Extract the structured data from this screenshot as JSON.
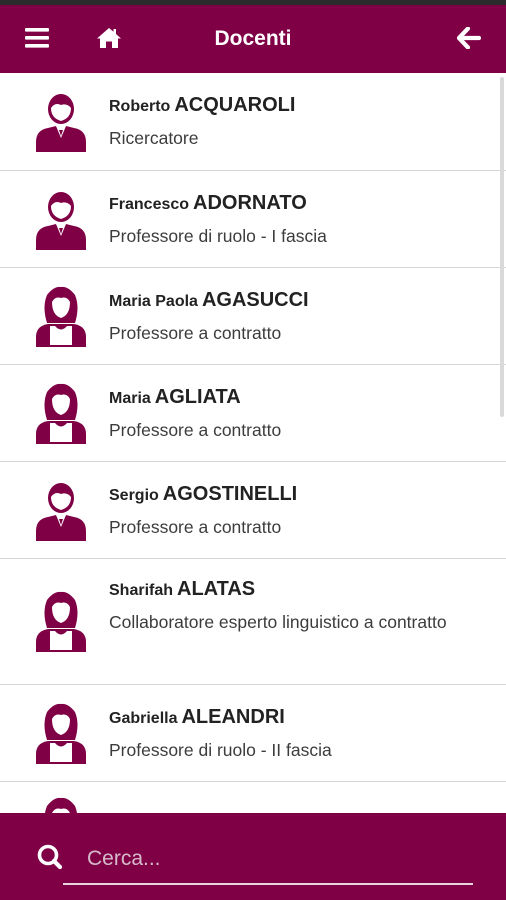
{
  "header": {
    "title": "Docenti",
    "menu_icon": "hamburger-menu-icon",
    "home_icon": "home-icon",
    "back_icon": "arrow-left-icon"
  },
  "colors": {
    "brand": "#800046",
    "text": "#222222",
    "muted": "#3c3c3c"
  },
  "docenti": [
    {
      "first": "Roberto",
      "last": "ACQUAROLI",
      "role": "Ricercatore",
      "gender": "male"
    },
    {
      "first": "Francesco",
      "last": "ADORNATO",
      "role": "Professore di ruolo - I fascia",
      "gender": "male"
    },
    {
      "first": "Maria Paola",
      "last": "AGASUCCI",
      "role": "Professore a contratto",
      "gender": "female"
    },
    {
      "first": "Maria",
      "last": "AGLIATA",
      "role": "Professore a contratto",
      "gender": "female"
    },
    {
      "first": "Sergio",
      "last": "AGOSTINELLI",
      "role": "Professore a contratto",
      "gender": "male"
    },
    {
      "first": "Sharifah",
      "last": "ALATAS",
      "role": "Collaboratore esperto linguistico a contratto",
      "gender": "female"
    },
    {
      "first": "Gabriella",
      "last": "ALEANDRI",
      "role": "Professore di ruolo - II fascia",
      "gender": "female"
    }
  ],
  "search": {
    "placeholder": "Cerca...",
    "value": "",
    "icon": "search-icon"
  }
}
